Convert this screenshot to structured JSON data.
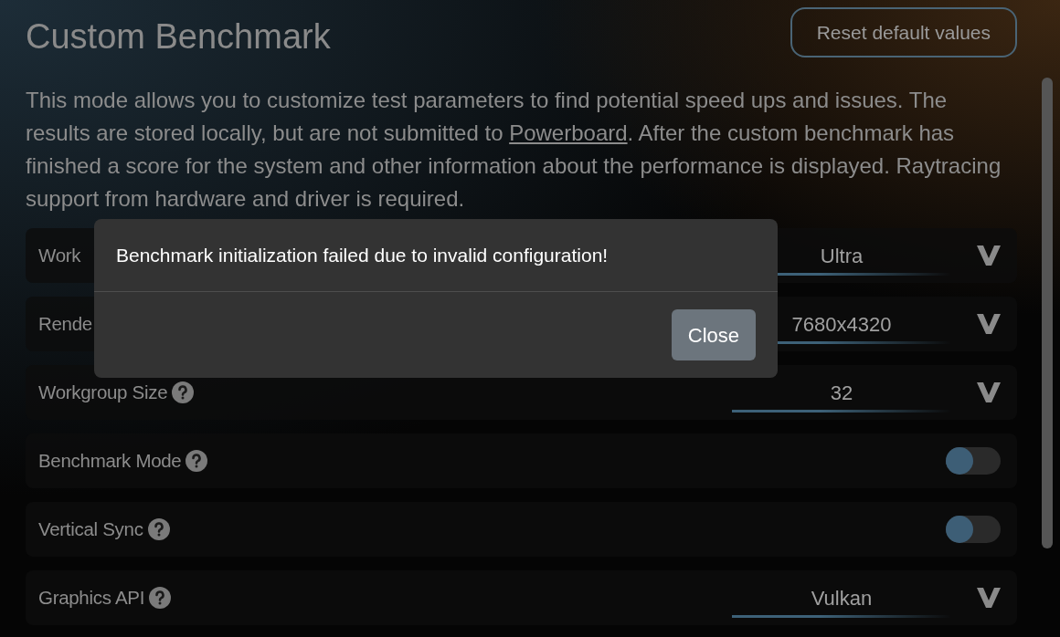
{
  "header": {
    "title": "Custom Benchmark",
    "reset_button": "Reset default values"
  },
  "description": {
    "before": "This mode allows you to customize test parameters to find potential speed ups and issues. The results are stored locally, but are not submitted to ",
    "link": "Powerboard",
    "after": ". After the custom benchmark has finished a score for the system and other information about the performance is displayed. Raytracing support from hardware and driver is required."
  },
  "settings": [
    {
      "kind": "select",
      "label": "Work",
      "help": false,
      "value": "Ultra"
    },
    {
      "kind": "select",
      "label": "Rende",
      "help": false,
      "value": "7680x4320"
    },
    {
      "kind": "select",
      "label": "Workgroup Size",
      "help": true,
      "value": "32"
    },
    {
      "kind": "toggle",
      "label": "Benchmark Mode",
      "help": true,
      "on": false
    },
    {
      "kind": "toggle",
      "label": "Vertical Sync",
      "help": true,
      "on": false
    },
    {
      "kind": "select",
      "label": "Graphics API",
      "help": true,
      "value": "Vulkan"
    }
  ],
  "dialog": {
    "message": "Benchmark initialization failed due to invalid configuration!",
    "close_button": "Close"
  }
}
